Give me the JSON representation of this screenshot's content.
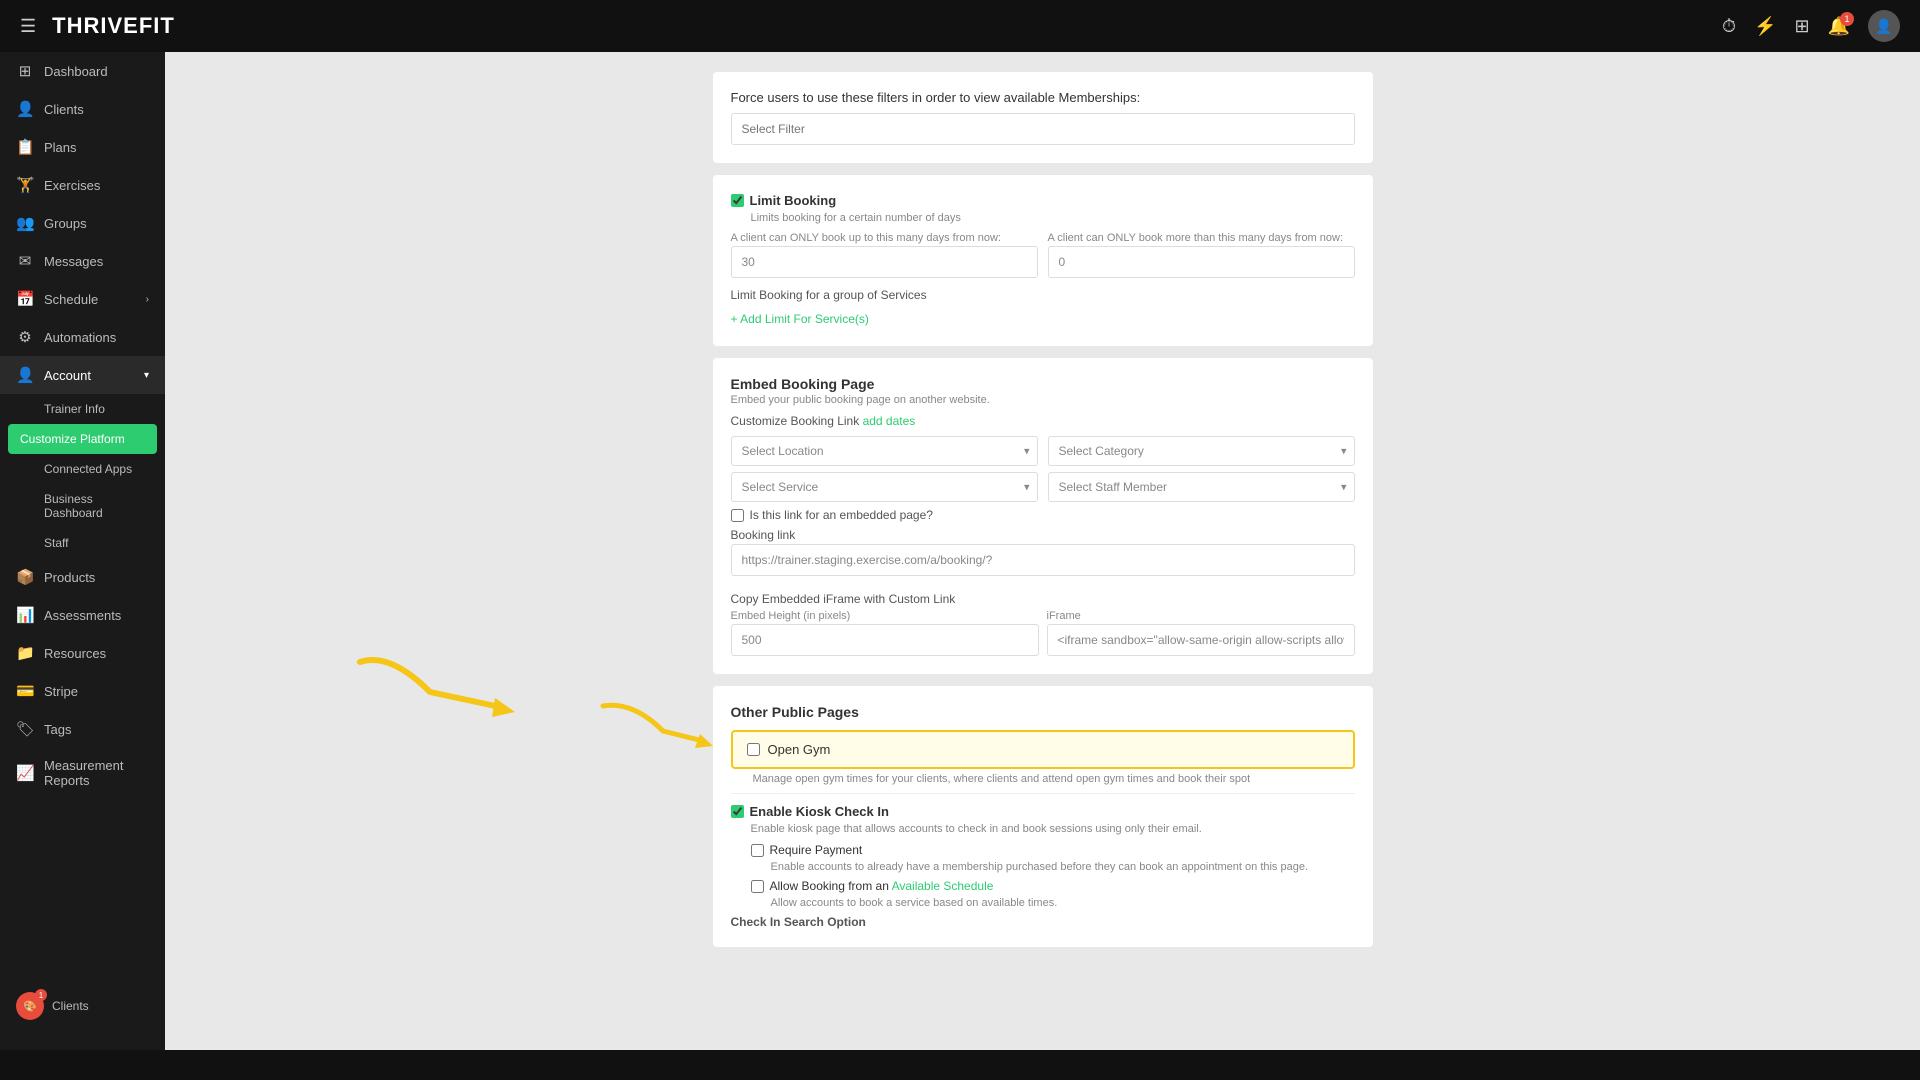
{
  "app": {
    "name": "THRIVEFIT",
    "menu_icon": "☰"
  },
  "topbar": {
    "icons": [
      "⏱",
      "⚡",
      "⊞"
    ],
    "notification_count": "1"
  },
  "sidebar": {
    "items": [
      {
        "id": "dashboard",
        "label": "Dashboard",
        "icon": "⊞"
      },
      {
        "id": "clients",
        "label": "Clients",
        "icon": "👤"
      },
      {
        "id": "plans",
        "label": "Plans",
        "icon": "📋"
      },
      {
        "id": "exercises",
        "label": "Exercises",
        "icon": "🏋"
      },
      {
        "id": "groups",
        "label": "Groups",
        "icon": "👥"
      },
      {
        "id": "messages",
        "label": "Messages",
        "icon": "✉"
      },
      {
        "id": "schedule",
        "label": "Schedule",
        "icon": "📅",
        "arrow": "›"
      },
      {
        "id": "automations",
        "label": "Automations",
        "icon": "⚙"
      },
      {
        "id": "account",
        "label": "Account",
        "icon": "👤",
        "arrow": "›",
        "expanded": true
      }
    ],
    "sub_items": [
      {
        "id": "trainer-info",
        "label": "Trainer Info",
        "active": false
      },
      {
        "id": "customize-platform",
        "label": "Customize Platform",
        "active": true
      },
      {
        "id": "connected-apps",
        "label": "Connected Apps",
        "active": false
      },
      {
        "id": "business-dashboard",
        "label": "Business Dashboard",
        "active": false
      },
      {
        "id": "staff",
        "label": "Staff",
        "active": false
      }
    ],
    "lower_items": [
      {
        "id": "products",
        "label": "Products",
        "icon": "📦"
      },
      {
        "id": "assessments",
        "label": "Assessments",
        "icon": "📊"
      },
      {
        "id": "resources",
        "label": "Resources",
        "icon": "📁"
      },
      {
        "id": "stripe",
        "label": "Stripe",
        "icon": "💳"
      },
      {
        "id": "tags",
        "label": "Tags",
        "icon": "🏷"
      },
      {
        "id": "measurement-reports",
        "label": "Measurement Reports",
        "icon": "📈"
      }
    ],
    "bottom_user": "Clients"
  },
  "main": {
    "force_filter": {
      "label": "Force users to use these filters in order to view available Memberships:",
      "placeholder": "Select Filter"
    },
    "limit_booking": {
      "checkbox_checked": true,
      "title": "Limit Booking",
      "description": "Limits booking for a certain number of days",
      "field1_label": "A client can ONLY book up to this many days from now:",
      "field1_value": "30",
      "field2_label": "A client can ONLY book more than this many days from now:",
      "field2_value": "0",
      "group_label": "Limit Booking for a group of Services",
      "add_link": "+ Add Limit For Service(s)"
    },
    "embed_booking": {
      "title": "Embed Booking Page",
      "description": "Embed your public booking page on another website.",
      "customize_prefix": "Customize Booking Link",
      "customize_link_text": "add dates",
      "select_location_placeholder": "Select Location",
      "select_category_placeholder": "Select Category",
      "select_service_placeholder": "Select Service",
      "select_staff_placeholder": "Select Staff Member",
      "is_embedded_label": "Is this link for an embedded page?",
      "booking_link_label": "Booking link",
      "booking_link_value": "https://trainer.staging.exercise.com/a/booking/?",
      "copy_embed_title": "Copy Embedded iFrame with Custom Link",
      "embed_height_label": "Embed Height (in pixels)",
      "embed_height_value": "500",
      "iframe_label": "iFrame",
      "iframe_value": "<iframe sandbox=\"allow-same-origin allow-scripts allow-popups allow-forms\" src=https"
    },
    "other_public": {
      "title": "Other Public Pages",
      "open_gym": {
        "checkbox_checked": false,
        "label": "Open Gym",
        "description": "Manage open gym times for your clients, where clients and attend open gym times and book their spot"
      }
    },
    "kiosk": {
      "checkbox_checked": true,
      "title": "Enable Kiosk Check In",
      "description": "Enable kiosk page that allows accounts to check in and book sessions using only their email.",
      "require_payment_checked": false,
      "require_payment_label": "Require Payment",
      "require_payment_desc": "Enable accounts to already have a membership purchased before they can book an appointment on this page.",
      "allow_booking_checked": false,
      "allow_booking_label": "Allow Booking from an Available Schedule",
      "allow_booking_link": "Available Schedule",
      "allow_booking_desc": "Allow accounts to book a service based on available times.",
      "check_in_label": "Check In Search Option"
    }
  }
}
